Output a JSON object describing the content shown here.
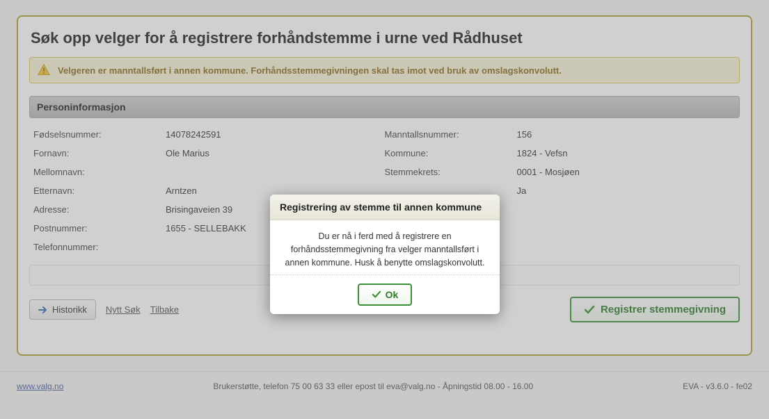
{
  "page": {
    "title": "Søk opp velger for å registrere forhåndstemme i urne ved Rådhuset"
  },
  "warning": {
    "message": "Velgeren er manntallsført i annen kommune. Forhåndsstemmegivningen skal tas imot ved bruk av omslagskonvolutt."
  },
  "section": {
    "person_info_header": "Personinformasjon"
  },
  "labels": {
    "fodselsnummer": "Fødselsnummer:",
    "fornavn": "Fornavn:",
    "mellomnavn": "Mellomnavn:",
    "etternavn": "Etternavn:",
    "adresse": "Adresse:",
    "postnummer": "Postnummer:",
    "telefonnummer": "Telefonnummer:",
    "manntallsnummer": "Manntallsnummer:",
    "kommune": "Kommune:",
    "stemmekrets": "Stemmekrets:",
    "right4": ""
  },
  "values": {
    "fodselsnummer": "14078242591",
    "fornavn": "Ole Marius",
    "mellomnavn": "",
    "etternavn": "Arntzen",
    "adresse": "Brisingaveien 39",
    "postnummer": "1655 - SELLEBAKK",
    "telefonnummer": "",
    "manntallsnummer": "156",
    "kommune": "1824 - Vefsn",
    "stemmekrets": "0001 - Mosjøen",
    "right4": "Ja"
  },
  "actions": {
    "historikk": "Historikk",
    "nytt_sok": "Nytt Søk",
    "tilbake": "Tilbake",
    "registrer": "Registrer stemmegivning"
  },
  "footer": {
    "url": "www.valg.no",
    "support": "Brukerstøtte, telefon 75 00 63 33 eller epost til eva@valg.no - Åpningstid 08.00 - 16.00",
    "version": "EVA - v3.6.0 - fe02"
  },
  "dialog": {
    "title": "Registrering av stemme til annen kommune",
    "body": "Du er nå i ferd med å registrere en forhåndsstemmegivning fra velger manntallsført i annen kommune. Husk å benytte omslagskonvolutt.",
    "ok": "Ok"
  }
}
